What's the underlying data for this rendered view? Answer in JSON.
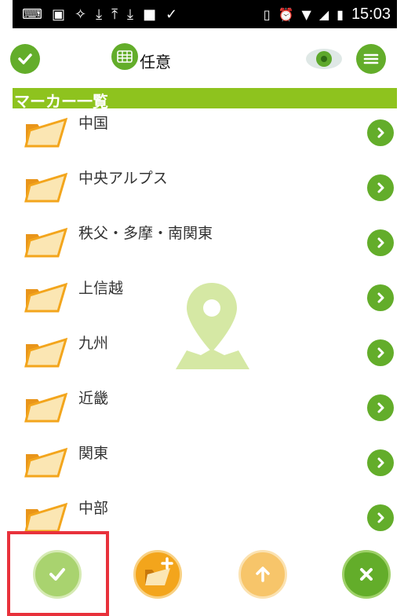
{
  "colors": {
    "accent": "#63ad2a",
    "band": "#8ec31e",
    "folder": "#f3a51c",
    "highlight": "#e8313b"
  },
  "statusbar": {
    "time": "15:03",
    "icons": [
      "keyboard-icon",
      "image-icon",
      "sun-icon",
      "download-icon",
      "upload-icon",
      "download-icon",
      "square-icon",
      "check-underline-icon",
      "vibrate-icon",
      "alarm-icon",
      "wifi-icon",
      "signal-icon",
      "battery-icon"
    ]
  },
  "topbar": {
    "title": "任意",
    "icons": [
      "check-icon",
      "grid-icon",
      "eye-icon",
      "menu-icon"
    ]
  },
  "section": {
    "title": "マーカー一覧"
  },
  "list": {
    "items": [
      {
        "label": "中国"
      },
      {
        "label": "中央アルプス"
      },
      {
        "label": "秩父・多摩・南関東"
      },
      {
        "label": "上信越"
      },
      {
        "label": "九州"
      },
      {
        "label": "近畿"
      },
      {
        "label": "関東"
      },
      {
        "label": "中部"
      }
    ]
  },
  "bottombar": {
    "icons": [
      "check-icon",
      "folder-add-icon",
      "up-arrow-icon",
      "close-icon"
    ]
  }
}
